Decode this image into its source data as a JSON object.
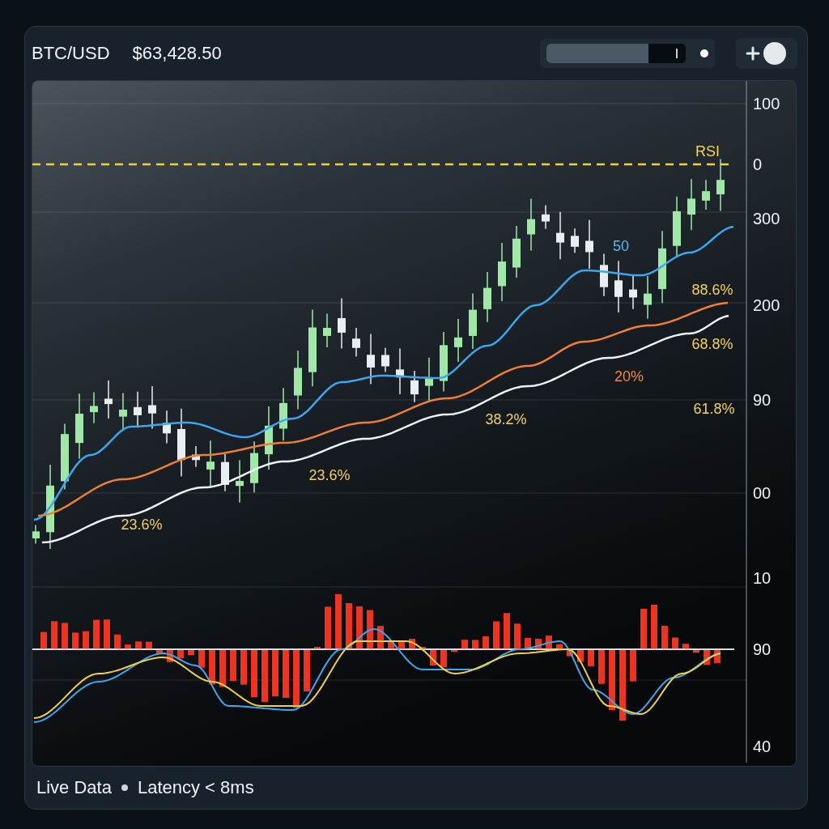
{
  "header": {
    "symbol": "BTC/USD",
    "price": "$63,428.50",
    "slider": {
      "level": 0.73
    },
    "toggle": {
      "on": true
    }
  },
  "chart": {
    "axis_labels": [
      "100",
      "0",
      "300",
      "200",
      "90",
      "00",
      "10",
      "90",
      "40"
    ],
    "annotations": [
      {
        "text": "RSI",
        "color": "#f2d25a"
      },
      {
        "text": "50",
        "color": "#5ab8f0"
      },
      {
        "text": "88.6%",
        "color": "#f2d25a"
      },
      {
        "text": "68.8%",
        "color": "#f2d25a"
      },
      {
        "text": "20%",
        "color": "#f08a3a"
      },
      {
        "text": "61.8%",
        "color": "#f2d25a"
      },
      {
        "text": "38.2%",
        "color": "#f2d25a"
      },
      {
        "text": "23.6%",
        "color": "#f2d25a"
      },
      {
        "text": "23.6%",
        "color": "#f2d25a"
      }
    ]
  },
  "status_bar": {
    "items": [
      "Live Data",
      "Latency < 8ms"
    ]
  }
}
